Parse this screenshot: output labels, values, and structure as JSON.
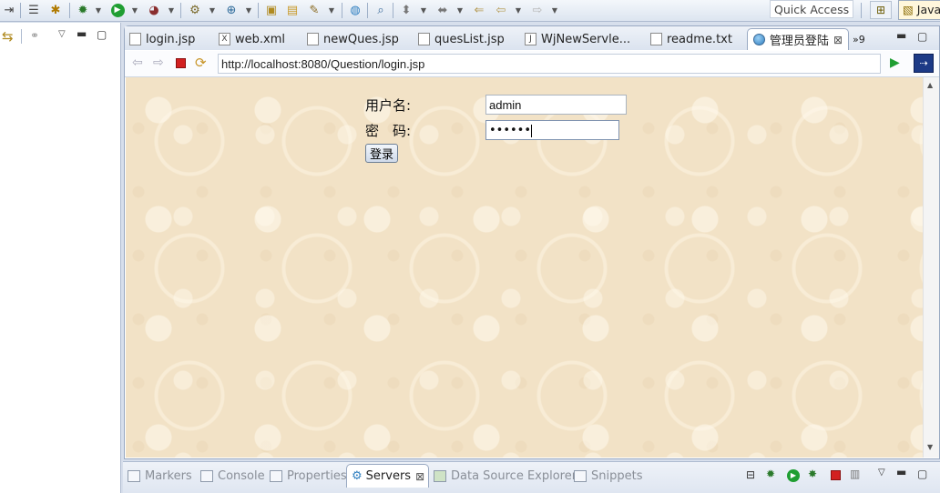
{
  "toolbar": {
    "icons": [
      "skip-icon",
      "menu-icon",
      "debug-step-icon",
      "debug-icon",
      "run-icon",
      "coverage-icon",
      "new-server-icon",
      "new-class-icon",
      "open-type-icon",
      "open-folder-icon",
      "pen-icon",
      "globe-icon",
      "search-icon",
      "annotation-icon",
      "back-icon",
      "prev-edit-icon",
      "next-edit-icon"
    ],
    "quick_access": "Quick Access",
    "perspective_label": "Java"
  },
  "editor_tabs": [
    {
      "label": "login.jsp",
      "icon": "file-icon"
    },
    {
      "label": "web.xml",
      "icon": "xml-file-icon"
    },
    {
      "label": "newQues.jsp",
      "icon": "file-icon"
    },
    {
      "label": "quesList.jsp",
      "icon": "file-icon"
    },
    {
      "label": "WjNewServle...",
      "icon": "java-file-icon"
    },
    {
      "label": "readme.txt",
      "icon": "text-file-icon"
    },
    {
      "label": "管理员登陆",
      "icon": "globe-icon",
      "active": true
    }
  ],
  "overflow_tabs": "»9",
  "browser": {
    "url": "http://localhost:8080/Question/login.jsp"
  },
  "form": {
    "username_label": "用户名:",
    "password_label": "密　码:",
    "username_value": "admin",
    "password_value": "••••••",
    "submit_label": "登录"
  },
  "bottom_tabs": [
    {
      "label": "Markers",
      "icon": "markers-icon"
    },
    {
      "label": "Console",
      "icon": "console-icon"
    },
    {
      "label": "Properties",
      "icon": "properties-icon"
    },
    {
      "label": "Servers",
      "icon": "servers-icon",
      "active": true
    },
    {
      "label": "Data Source Explorer",
      "icon": "database-icon"
    },
    {
      "label": "Snippets",
      "icon": "snippets-icon"
    }
  ],
  "colors": {
    "page_background": "#f2e2c6",
    "chrome_blue": "#d7dfec",
    "stop_red": "#d22020",
    "run_green": "#1f9e32"
  }
}
